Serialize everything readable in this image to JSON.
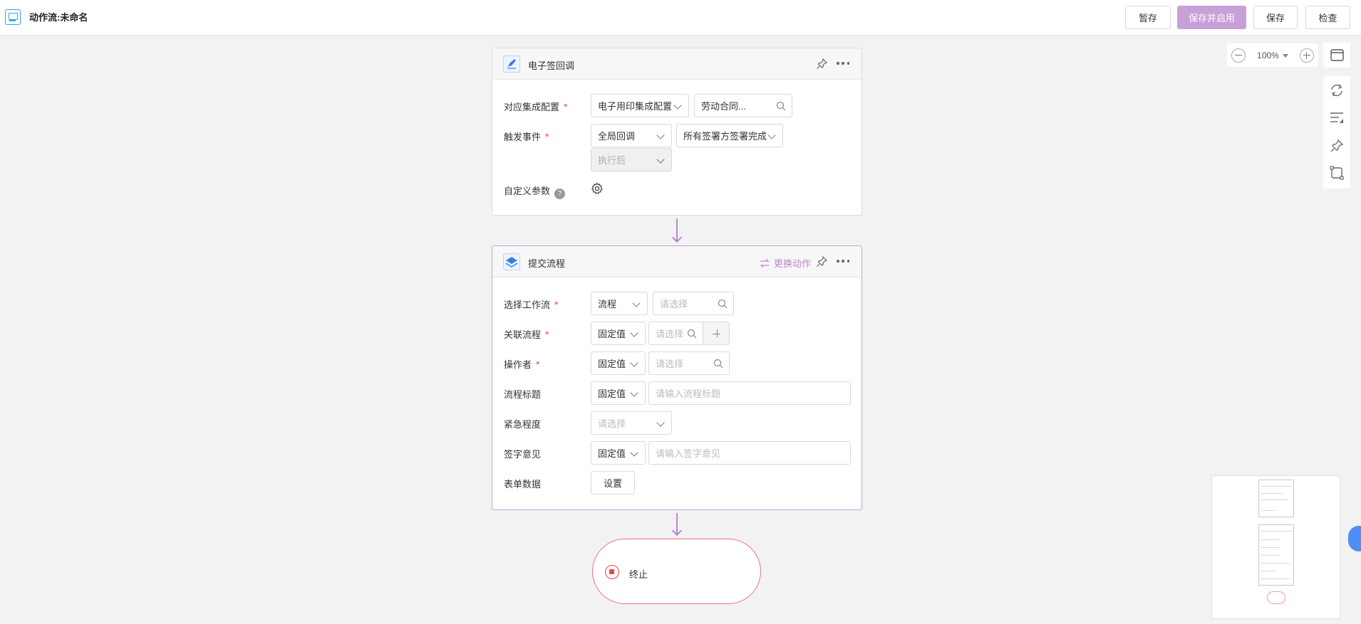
{
  "header": {
    "title": "动作流:未命名",
    "buttons": {
      "pause": "暂存",
      "save_enable": "保存并启用",
      "save": "保存",
      "check": "检查"
    }
  },
  "zoom": {
    "value": "100%"
  },
  "card1": {
    "title": "电子签回调",
    "fields": {
      "config_label": "对应集成配置",
      "config_select": "电子用印集成配置",
      "config_search": "劳动合同...",
      "event_label": "触发事件",
      "event_select": "全局回调",
      "event_detail": "所有签署方签署完成",
      "event_timing": "执行后",
      "custom_label": "自定义参数"
    }
  },
  "card2": {
    "title": "提交流程",
    "swap_label": "更换动作",
    "fields": {
      "workflow_label": "选择工作流",
      "workflow_type": "流程",
      "workflow_placeholder": "请选择",
      "related_label": "关联流程",
      "related_type": "固定值",
      "related_placeholder": "请选择",
      "operator_label": "操作者",
      "operator_type": "固定值",
      "operator_placeholder": "请选择",
      "flow_title_label": "流程标题",
      "flow_title_type": "固定值",
      "flow_title_placeholder": "请输入流程标题",
      "urgency_label": "紧急程度",
      "urgency_placeholder": "请选择",
      "sign_label": "签字意见",
      "sign_type": "固定值",
      "sign_placeholder": "请输入签字意见",
      "form_label": "表单数据",
      "form_button": "设置"
    }
  },
  "end_node": {
    "label": "终止"
  },
  "icons": [
    "app-icon",
    "esign-icon",
    "pin-icon",
    "more-icon",
    "gear-icon",
    "help-icon",
    "swap-icon",
    "search-icon",
    "plus-icon",
    "stop-icon",
    "zoom-out-icon",
    "zoom-in-icon",
    "fit-screen-icon",
    "refresh-icon",
    "sort-icon",
    "pin-icon",
    "crop-icon"
  ],
  "colors": {
    "accent": "#b987d0",
    "primary_button": "#c7a0d8",
    "required": "#e84a4a",
    "end_border": "#f0707a"
  }
}
